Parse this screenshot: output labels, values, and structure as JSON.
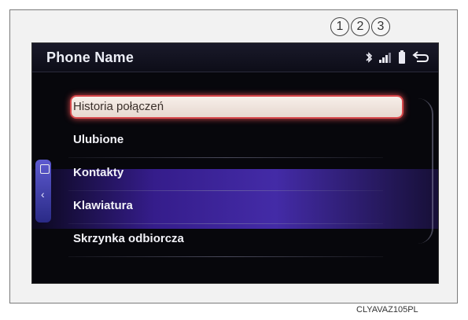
{
  "callouts": [
    "1",
    "2",
    "3"
  ],
  "header": {
    "title": "Phone Name",
    "icons": [
      "bluetooth-icon",
      "signal-icon",
      "battery-icon",
      "back-icon"
    ]
  },
  "menu": {
    "items": [
      {
        "label": "Historia połączeń",
        "selected": true
      },
      {
        "label": "Ulubione"
      },
      {
        "label": "Kontakty"
      },
      {
        "label": "Klawiatura"
      },
      {
        "label": "Skrzynka odbiorcza"
      }
    ]
  },
  "figure_code": "CLYAVAZ105PL",
  "colors": {
    "selection_border": "#d7474a",
    "highlight_band": "#4a2fb8",
    "screen_bg": "#07070c"
  }
}
